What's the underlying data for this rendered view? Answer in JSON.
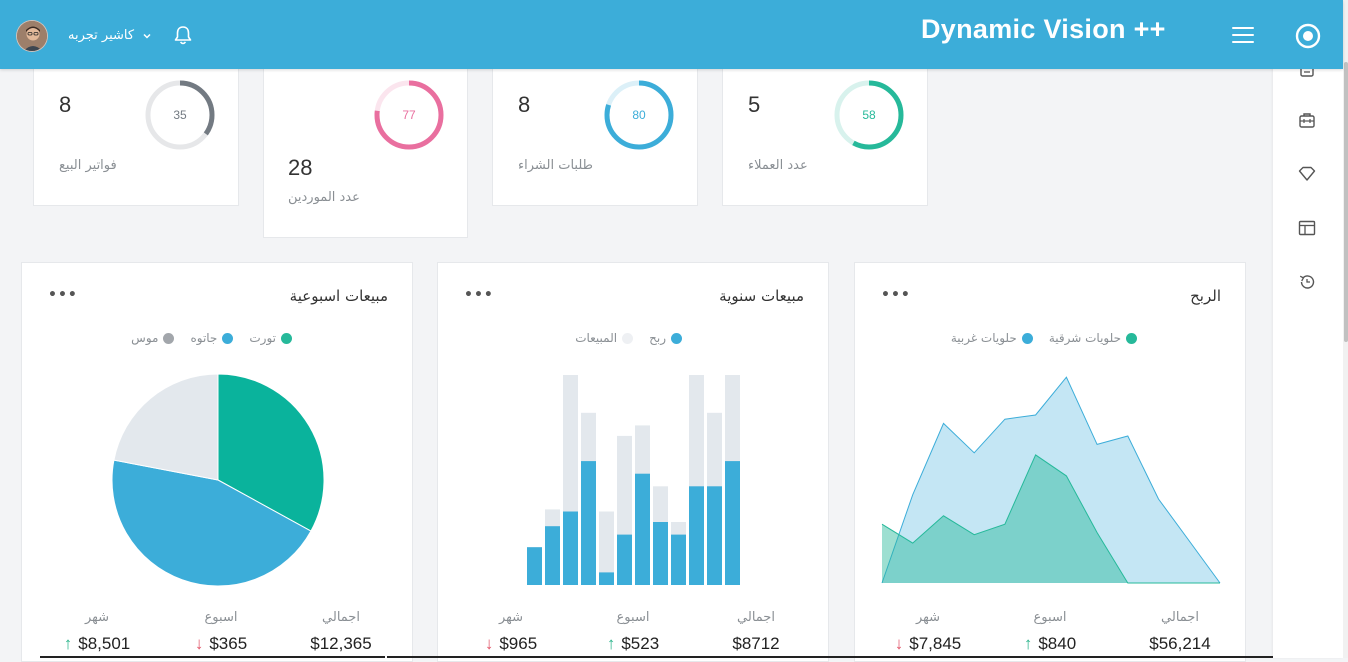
{
  "header": {
    "brand": "Dynamic Vision ++",
    "user_name": "كاشير تجربه",
    "icons": [
      "menu-icon",
      "target-icon",
      "bell-icon",
      "chevron-down-icon"
    ]
  },
  "sidebar": {
    "icons": [
      "document-icon",
      "briefcase-icon",
      "diamond-icon",
      "table-icon",
      "history-icon"
    ]
  },
  "stats": [
    {
      "value": "5",
      "label": "عدد العملاء",
      "percent": 58,
      "percent_label": "58",
      "color": "#26b99a"
    },
    {
      "value": "8",
      "label": "طلبات الشراء",
      "percent": 80,
      "percent_label": "80",
      "color": "#3cadd9"
    },
    {
      "value": "28",
      "label": "عدد الموردين",
      "percent": 77,
      "percent_label": "77",
      "color": "#e96f9f"
    },
    {
      "value": "8",
      "label": "فواتير البيع",
      "percent": 35,
      "percent_label": "35",
      "color": "#737a82"
    }
  ],
  "cards": [
    {
      "title": "الربح",
      "legend": [
        {
          "label": "حلويات شرقية",
          "color": "#26b99a"
        },
        {
          "label": "حلويات غربية",
          "color": "#3cadd9"
        }
      ],
      "footer": [
        {
          "label": "اجمالي",
          "value": "$56,214",
          "trend": ""
        },
        {
          "label": "اسبوع",
          "value": "$840",
          "trend": "↑"
        },
        {
          "label": "شهر",
          "value": "$7,845",
          "trend": "↓"
        }
      ]
    },
    {
      "title": "مبيعات سنوية",
      "legend": [
        {
          "label": "ربح",
          "color": "#3cadd9"
        },
        {
          "label": "المبيعات",
          "color": "#eef0f3"
        }
      ],
      "footer": [
        {
          "label": "اجمالي",
          "value": "$8712",
          "trend": ""
        },
        {
          "label": "اسبوع",
          "value": "$523",
          "trend": "↑"
        },
        {
          "label": "شهر",
          "value": "$965",
          "trend": "↓"
        }
      ]
    },
    {
      "title": "مبيعات اسبوعية",
      "legend": [
        {
          "label": "تورت",
          "color": "#26b99a"
        },
        {
          "label": "جاتوه",
          "color": "#3cadd9"
        },
        {
          "label": "موس",
          "color": "#a2a6ab"
        }
      ],
      "footer": [
        {
          "label": "اجمالي",
          "value": "$12,365",
          "trend": ""
        },
        {
          "label": "اسبوع",
          "value": "$365",
          "trend": "↓"
        },
        {
          "label": "شهر",
          "value": "$8,501",
          "trend": "↑"
        }
      ]
    }
  ],
  "chart_data": [
    {
      "type": "area",
      "title": "الربح",
      "x": [
        1,
        2,
        3,
        4,
        5,
        6,
        7,
        8,
        9,
        10,
        11,
        12
      ],
      "ylim": [
        0,
        100
      ],
      "series": [
        {
          "name": "حلويات غربية",
          "values": [
            0,
            42,
            76,
            62,
            78,
            80,
            98,
            66,
            70,
            40,
            20,
            0
          ],
          "color": "#3cadd9"
        },
        {
          "name": "حلويات شرقية",
          "values": [
            28,
            19,
            32,
            23,
            28,
            61,
            51,
            24,
            0,
            0,
            0,
            0
          ],
          "color": "#26b99a"
        }
      ],
      "legend_position": "top-center",
      "grid": false
    },
    {
      "type": "bar",
      "title": "مبيعات سنوية",
      "categories": [
        "1",
        "2",
        "3",
        "4",
        "5",
        "6",
        "7",
        "8",
        "9",
        "10",
        "11",
        "12"
      ],
      "ylim": [
        0,
        100
      ],
      "stacked_overlay": true,
      "series": [
        {
          "name": "ربح",
          "values": [
            18,
            28,
            35,
            59,
            6,
            24,
            53,
            30,
            24,
            47,
            47,
            59
          ],
          "color": "#3cadd9"
        },
        {
          "name": "المبيعات",
          "values": [
            18,
            36,
            100,
            82,
            35,
            71,
            76,
            47,
            30,
            100,
            82,
            100
          ],
          "color": "#e3e8ed"
        }
      ],
      "legend_position": "top-center",
      "grid": false
    },
    {
      "type": "pie",
      "title": "مبيعات اسبوعية",
      "slices": [
        {
          "name": "تورت",
          "value": 33,
          "color": "#0ab39c"
        },
        {
          "name": "جاتوه",
          "value": 45,
          "color": "#3cadd9"
        },
        {
          "name": "موس",
          "value": 22,
          "color": "#e3e8ed"
        }
      ],
      "legend_position": "top-center"
    }
  ]
}
